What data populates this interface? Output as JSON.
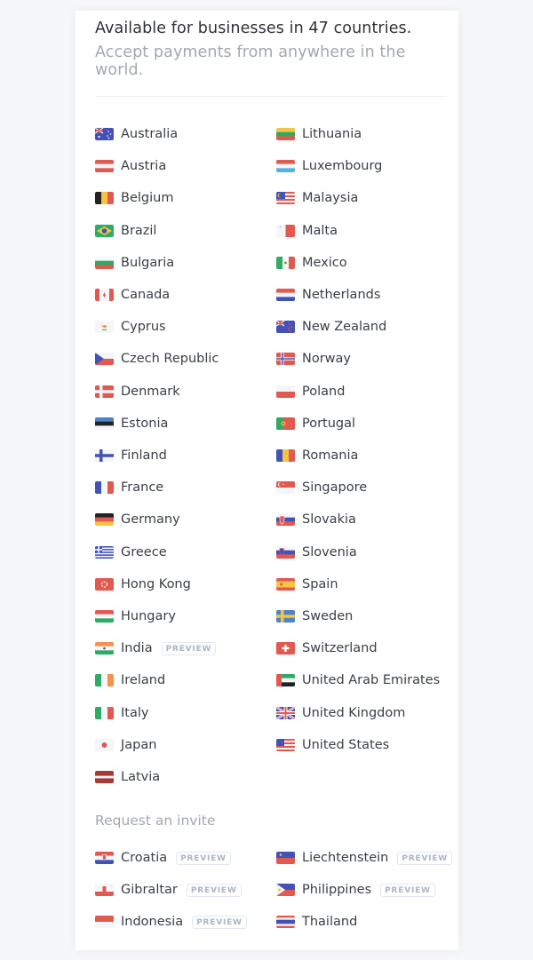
{
  "header": {
    "title": "Available for businesses in 47 countries.",
    "subtitle": "Accept payments from anywhere in the world."
  },
  "available": {
    "left": [
      {
        "name": "Australia",
        "flag": "australia"
      },
      {
        "name": "Austria",
        "flag": "austria"
      },
      {
        "name": "Belgium",
        "flag": "belgium"
      },
      {
        "name": "Brazil",
        "flag": "brazil"
      },
      {
        "name": "Bulgaria",
        "flag": "bulgaria"
      },
      {
        "name": "Canada",
        "flag": "canada"
      },
      {
        "name": "Cyprus",
        "flag": "cyprus"
      },
      {
        "name": "Czech Republic",
        "flag": "czech"
      },
      {
        "name": "Denmark",
        "flag": "denmark"
      },
      {
        "name": "Estonia",
        "flag": "estonia"
      },
      {
        "name": "Finland",
        "flag": "finland"
      },
      {
        "name": "France",
        "flag": "france"
      },
      {
        "name": "Germany",
        "flag": "germany"
      },
      {
        "name": "Greece",
        "flag": "greece"
      },
      {
        "name": "Hong Kong",
        "flag": "hongkong"
      },
      {
        "name": "Hungary",
        "flag": "hungary"
      },
      {
        "name": "India",
        "flag": "india",
        "badge": "PREVIEW"
      },
      {
        "name": "Ireland",
        "flag": "ireland"
      },
      {
        "name": "Italy",
        "flag": "italy"
      },
      {
        "name": "Japan",
        "flag": "japan"
      },
      {
        "name": "Latvia",
        "flag": "latvia"
      }
    ],
    "right": [
      {
        "name": "Lithuania",
        "flag": "lithuania"
      },
      {
        "name": "Luxembourg",
        "flag": "luxembourg"
      },
      {
        "name": "Malaysia",
        "flag": "malaysia"
      },
      {
        "name": "Malta",
        "flag": "malta"
      },
      {
        "name": "Mexico",
        "flag": "mexico"
      },
      {
        "name": "Netherlands",
        "flag": "netherlands"
      },
      {
        "name": "New Zealand",
        "flag": "newzealand"
      },
      {
        "name": "Norway",
        "flag": "norway"
      },
      {
        "name": "Poland",
        "flag": "poland"
      },
      {
        "name": "Portugal",
        "flag": "portugal"
      },
      {
        "name": "Romania",
        "flag": "romania"
      },
      {
        "name": "Singapore",
        "flag": "singapore"
      },
      {
        "name": "Slovakia",
        "flag": "slovakia"
      },
      {
        "name": "Slovenia",
        "flag": "slovenia"
      },
      {
        "name": "Spain",
        "flag": "spain"
      },
      {
        "name": "Sweden",
        "flag": "sweden"
      },
      {
        "name": "Switzerland",
        "flag": "switzerland"
      },
      {
        "name": "United Arab Emirates",
        "flag": "uae"
      },
      {
        "name": "United Kingdom",
        "flag": "uk"
      },
      {
        "name": "United States",
        "flag": "us"
      }
    ]
  },
  "invite": {
    "title": "Request an invite",
    "left": [
      {
        "name": "Croatia",
        "flag": "croatia",
        "badge": "PREVIEW"
      },
      {
        "name": "Gibraltar",
        "flag": "gibraltar",
        "badge": "PREVIEW"
      },
      {
        "name": "Indonesia",
        "flag": "indonesia",
        "badge": "PREVIEW"
      }
    ],
    "right": [
      {
        "name": "Liechtenstein",
        "flag": "liechtenstein",
        "badge": "PREVIEW"
      },
      {
        "name": "Philippines",
        "flag": "philippines",
        "badge": "PREVIEW"
      },
      {
        "name": "Thailand",
        "flag": "thailand"
      }
    ]
  },
  "colors": {
    "red": "#e25950",
    "blue": "#4452b8",
    "white": "#f4f6f9",
    "green": "#2eab64",
    "yellow": "#f5c443",
    "black": "#222222",
    "orange": "#f5914b",
    "lightblue": "#54b3e6",
    "maroon": "#a73a36",
    "sky": "#4b84c9"
  }
}
